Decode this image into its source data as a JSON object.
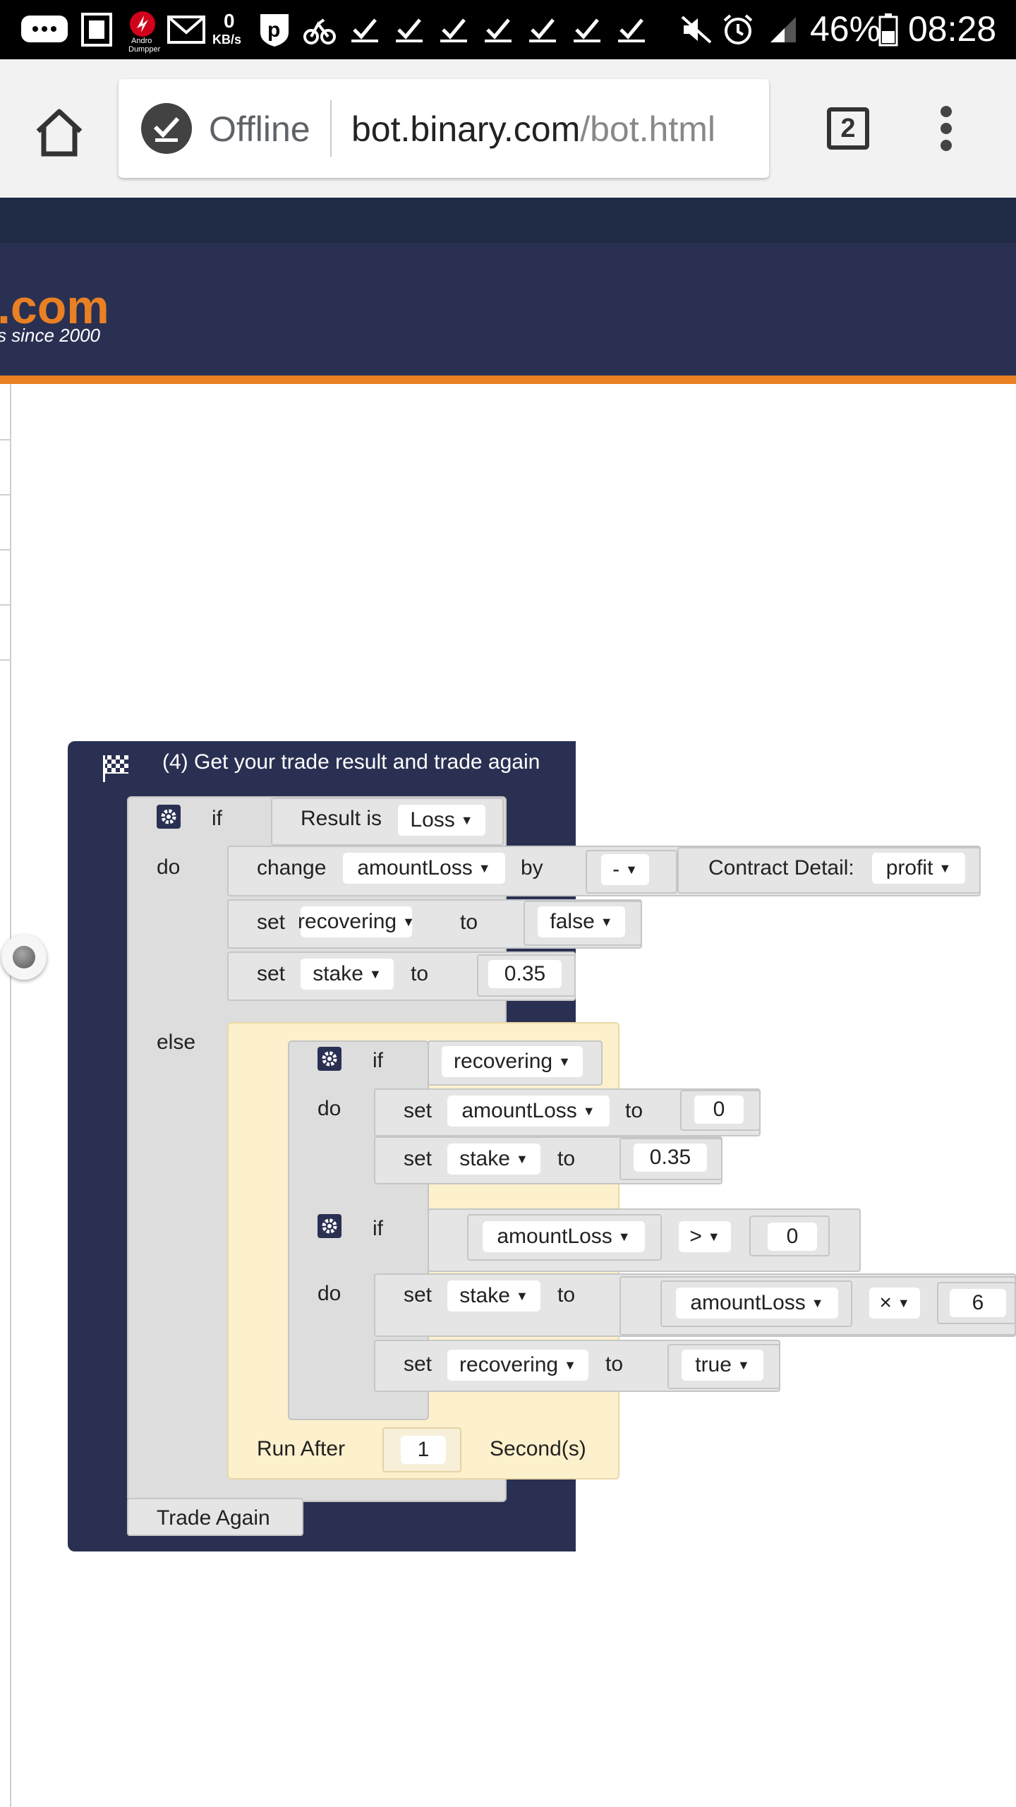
{
  "status_bar": {
    "net_speed_value": "0",
    "net_speed_unit": "KB/s",
    "app_label_line1": "Andro",
    "app_label_line2": "Dumpper",
    "battery_percent": "46%",
    "time": "08:28"
  },
  "browser": {
    "offline_label": "Offline",
    "url_host": "bot.binary.com",
    "url_path": "/bot.html",
    "tab_count": "2"
  },
  "site": {
    "logo_text": ".com",
    "tagline": "s since 2000",
    "accent_color": "#e98024",
    "navy_color": "#2a3052"
  },
  "blocks": {
    "header_title": "(4) Get your trade result and trade again",
    "if_label": "if",
    "do_label": "do",
    "else_label": "else",
    "set_label": "set",
    "to_label": "to",
    "change_label": "change",
    "by_label": "by",
    "result_is": "Result is",
    "result_value": "Loss",
    "amount_loss": "amountLoss",
    "minus_op": "-",
    "contract_detail": "Contract Detail:",
    "contract_field": "profit",
    "recovering": "recovering",
    "false_value": "false",
    "true_value": "true",
    "stake": "stake",
    "stake_value": "0.35",
    "zero_value": "0",
    "gt_op": ">",
    "mult_op": "×",
    "mult_value": "6",
    "run_after": "Run After",
    "run_after_value": "1",
    "seconds": "Second(s)",
    "trade_again": "Trade Again"
  }
}
